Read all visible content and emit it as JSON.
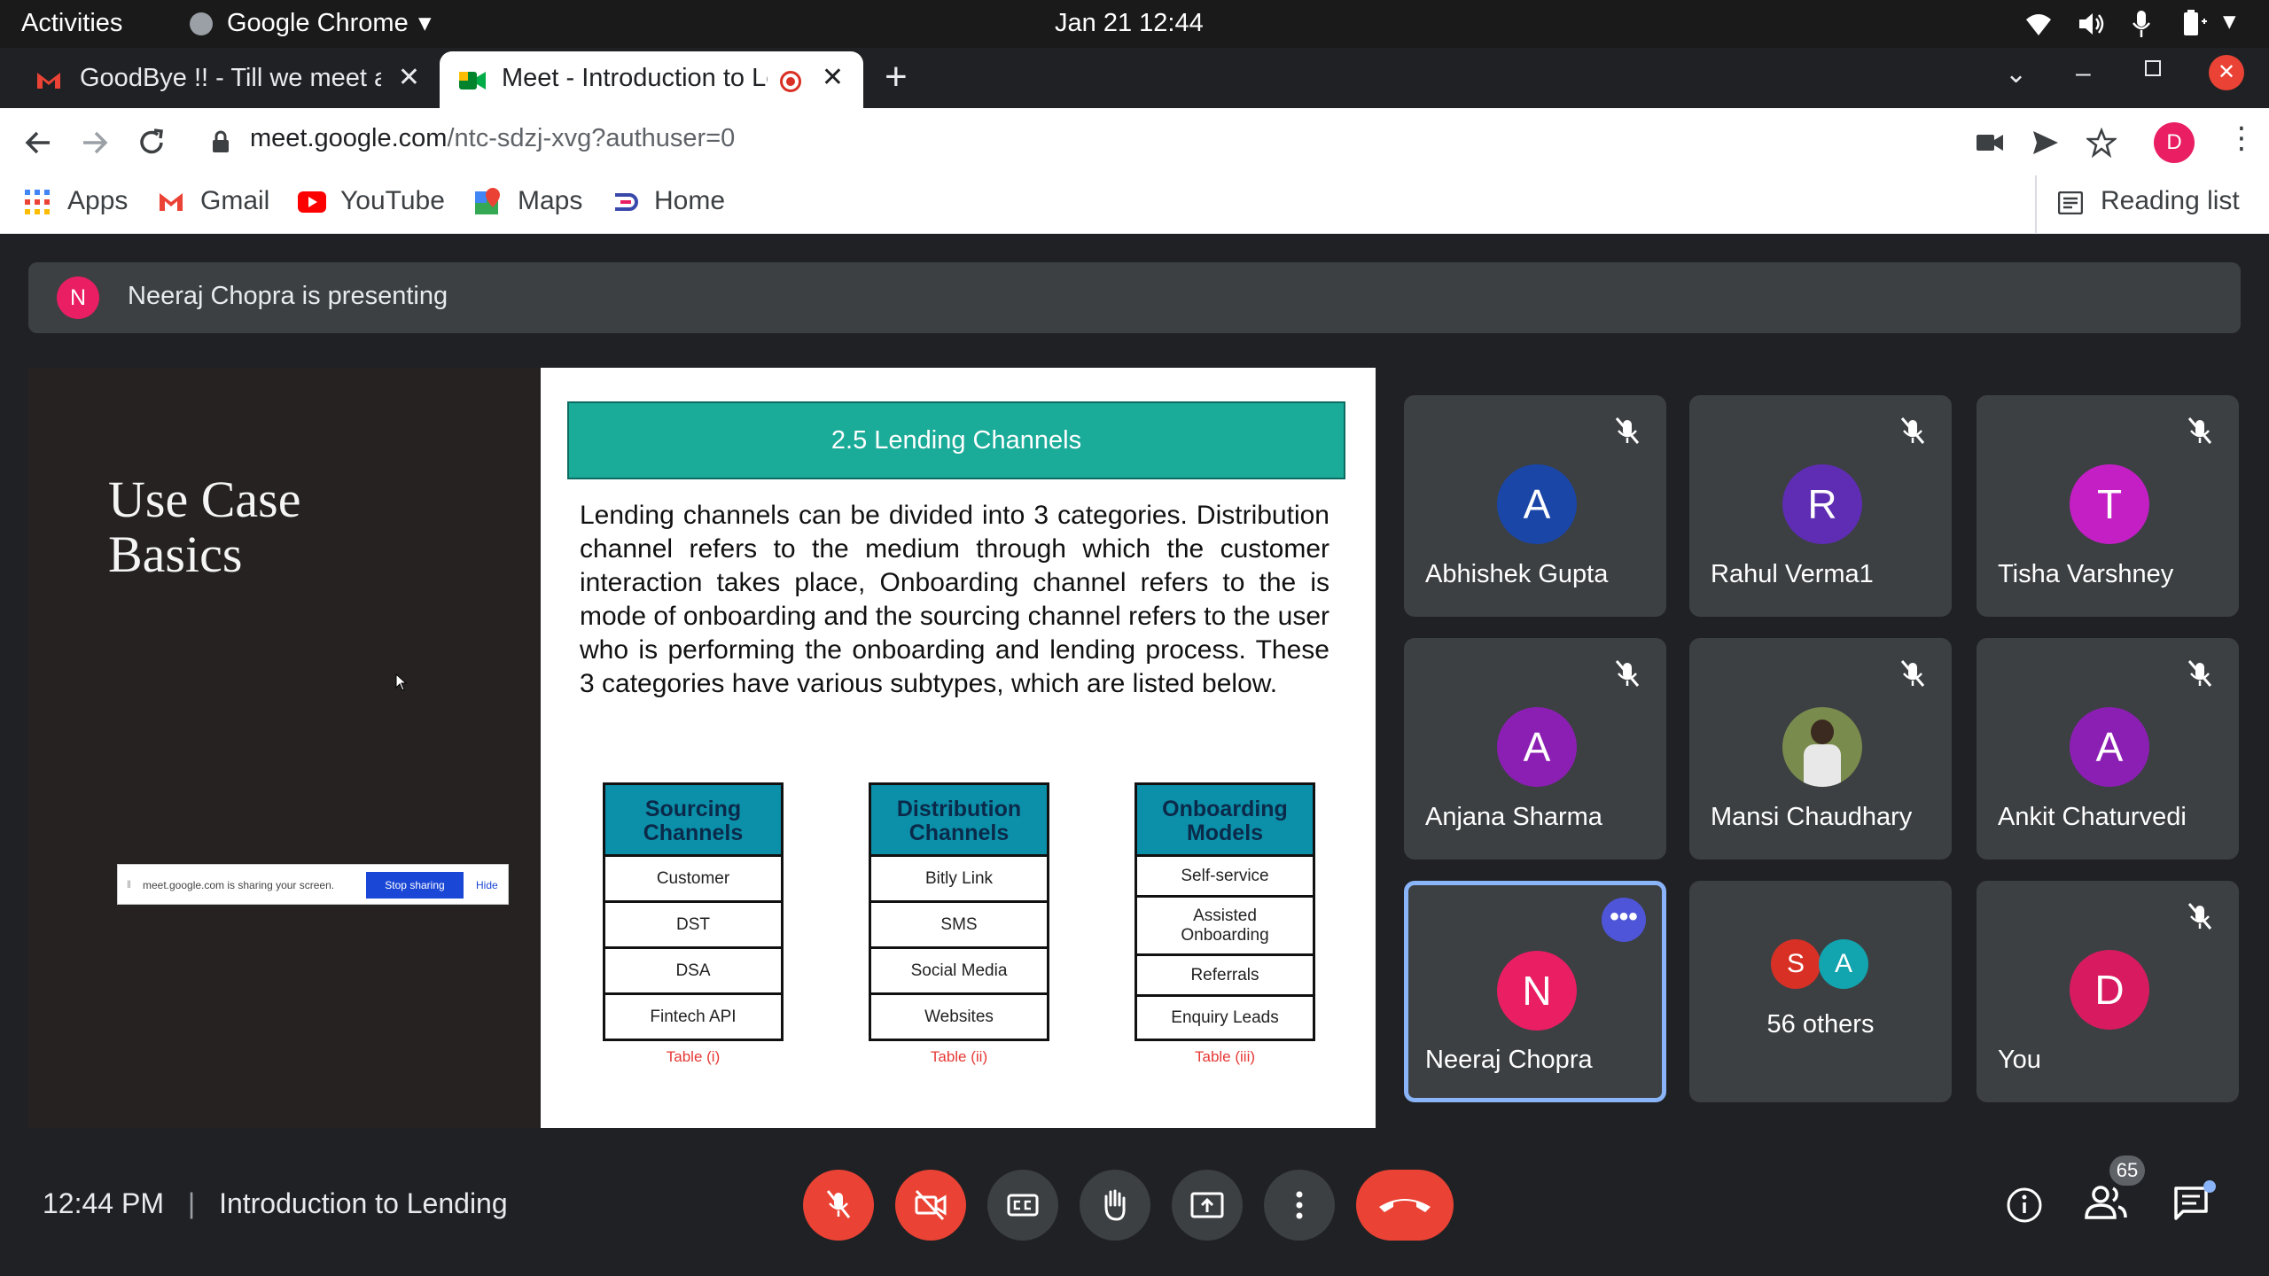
{
  "os_bar": {
    "activities": "Activities",
    "app_name": "Google Chrome",
    "datetime": "Jan 21  12:44"
  },
  "browser": {
    "tabs": [
      {
        "title": "GoodBye !! - Till we meet again"
      },
      {
        "title": "Meet - Introduction to Lending",
        "active": true
      }
    ],
    "url_host": "meet.google.com",
    "url_path": "/ntc-sdzj-xvg?authuser=0",
    "profile_initial": "D",
    "bookmarks": [
      {
        "label": "Apps",
        "icon": "apps-grid-icon"
      },
      {
        "label": "Gmail",
        "icon": "gmail-icon"
      },
      {
        "label": "YouTube",
        "icon": "youtube-icon"
      },
      {
        "label": "Maps",
        "icon": "maps-icon"
      },
      {
        "label": "Home",
        "icon": "home-icon"
      }
    ],
    "reading_list": "Reading list"
  },
  "meet": {
    "presenting_initial": "N",
    "presenting_text": "Neeraj Chopra is presenting",
    "slide": {
      "left_title_line1": "Use Case",
      "left_title_line2": "Basics",
      "share_bar_text": "meet.google.com is sharing your screen.",
      "share_stop": "Stop sharing",
      "share_hide": "Hide",
      "heading": "2.5 Lending Channels",
      "body": "Lending channels can be divided into 3 categories. Distribution channel refers to the medium through which the customer interaction takes place, Onboarding channel refers to the is mode of onboarding and the sourcing channel refers to the user who is performing the onboarding and lending process. These 3 categories have various subtypes, which are listed below.",
      "tables": [
        {
          "head": "Sourcing Channels",
          "rows": [
            "Customer",
            "DST",
            "DSA",
            "Fintech API"
          ],
          "caption": "Table (i)"
        },
        {
          "head": "Distribution Channels",
          "rows": [
            "Bitly Link",
            "SMS",
            "Social Media",
            "Websites"
          ],
          "caption": "Table (ii)"
        },
        {
          "head": "Onboarding Models",
          "rows": [
            "Self-service",
            "Assisted Onboarding",
            "Referrals",
            "Enquiry Leads"
          ],
          "caption": "Table (iii)"
        }
      ]
    },
    "participants": [
      {
        "initial": "A",
        "name": "Abhishek Gupta",
        "color": "#1a46a8"
      },
      {
        "initial": "R",
        "name": "Rahul Verma1",
        "color": "#5e2db3"
      },
      {
        "initial": "T",
        "name": "Tisha Varshney",
        "color": "#c41fc4"
      },
      {
        "initial": "A",
        "name": "Anjana Sharma",
        "color": "#8c1fb3"
      },
      {
        "initial": "",
        "name": "Mansi Chaudhary",
        "color": "#7a8b4e"
      },
      {
        "initial": "A",
        "name": "Ankit Chaturvedi",
        "color": "#8c1fb3"
      },
      {
        "initial": "N",
        "name": "Neeraj Chopra",
        "color": "#e91e63"
      },
      {
        "initial": "",
        "name": "56 others",
        "color": ""
      },
      {
        "initial": "D",
        "name": "You",
        "color": "#d81b60"
      }
    ],
    "others": {
      "a": "S",
      "b": "A"
    },
    "footer": {
      "time": "12:44 PM",
      "separator": "|",
      "meeting_title": "Introduction to Lending",
      "people_count": "65"
    }
  }
}
